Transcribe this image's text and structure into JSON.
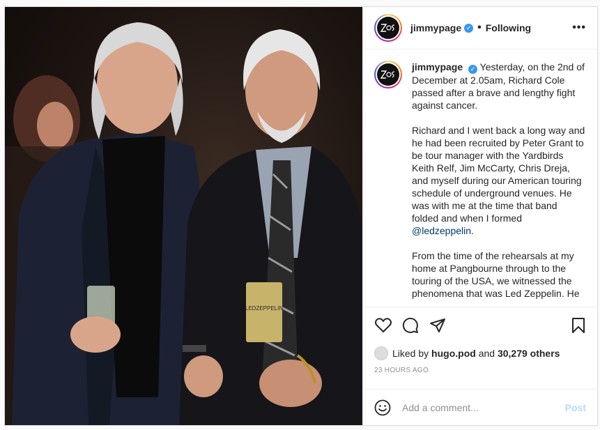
{
  "post": {
    "username": "jimmypage",
    "follow_status": "Following",
    "avatar_text": "ZoSo",
    "caption": {
      "username": "jimmypage",
      "p1_text": "Yesterday, on the 2nd of December at 2.05am, Richard Cole passed after a brave and lengthy fight against cancer.",
      "p2_text": "Richard and I went back a long way and he had been recruited by Peter Grant to be tour manager with the Yardbirds Keith Relf, Jim McCarty, Chris Dreja, and myself during our American touring schedule of underground venues. He was with me at the time that band folded and when I formed ",
      "p2_mention": "@ledzeppelin",
      "p2_end": ".",
      "p3_text": "From the time of the rehearsals at my home at Pangbourne through to the touring of the USA, we witnessed the phenomena that was Led Zeppelin. He"
    },
    "likes": {
      "prefix": "Liked by",
      "user": "hugo.pod",
      "and": "and",
      "others": "30,279 others"
    },
    "timestamp": "23 HOURS AGO",
    "comment": {
      "placeholder": "Add a comment...",
      "post_label": "Post"
    },
    "photo_badge": "LEDZEPPELIN"
  },
  "colors": {
    "verified": "#3897f0",
    "link": "#00376b",
    "post_disabled": "#b3dbff",
    "muted": "#8e8e8e"
  },
  "icons": [
    "verified-badge-icon",
    "more-options-icon",
    "heart-icon",
    "comment-icon",
    "share-icon",
    "bookmark-icon",
    "emoji-icon"
  ]
}
